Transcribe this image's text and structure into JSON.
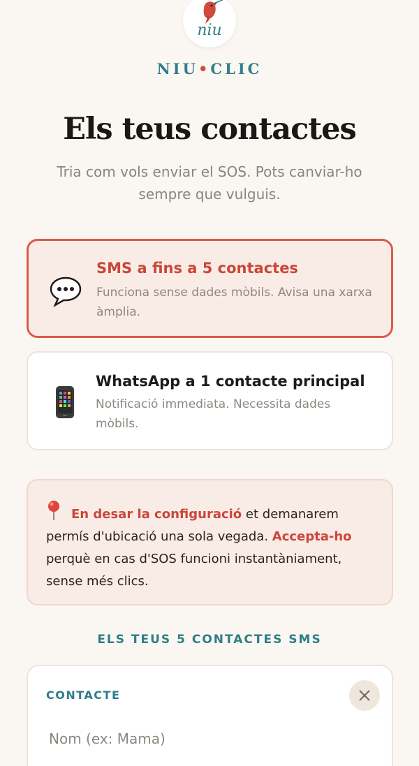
{
  "brand": {
    "logo_text": "niu",
    "name_left": "NIU",
    "separator": "•",
    "name_right": "CLIC",
    "accent_color": "#d24a3c",
    "teal_color": "#2f7d8a"
  },
  "header": {
    "title": "Els teus contactes",
    "subtitle": "Tria com vols enviar el SOS. Pots canviar-ho sempre que vulguis."
  },
  "options": [
    {
      "icon": "speech-bubble-icon",
      "title": "SMS a fins a 5 contactes",
      "description": "Funciona sense dades mòbils. Avisa una xarxa àmplia.",
      "selected": true
    },
    {
      "icon": "mobile-phone-icon",
      "title": "WhatsApp a 1 contacte principal",
      "description": "Notificació immediata. Necessita dades mòbils.",
      "selected": false
    }
  ],
  "notice": {
    "icon": "location-pin-icon",
    "highlight_1": "En desar la configuració",
    "text_1": " et demanarem permís d'ubicació una sola vegada. ",
    "highlight_2": "Accepta-ho",
    "text_2": " perquè en cas d'SOS funcioni instantàniament, sense més clics."
  },
  "contacts_section": {
    "title": "ELS TEUS 5 CONTACTES SMS",
    "contact_label": "CONTACTE",
    "name_placeholder": "Nom (ex: Mama)",
    "name_value": ""
  }
}
